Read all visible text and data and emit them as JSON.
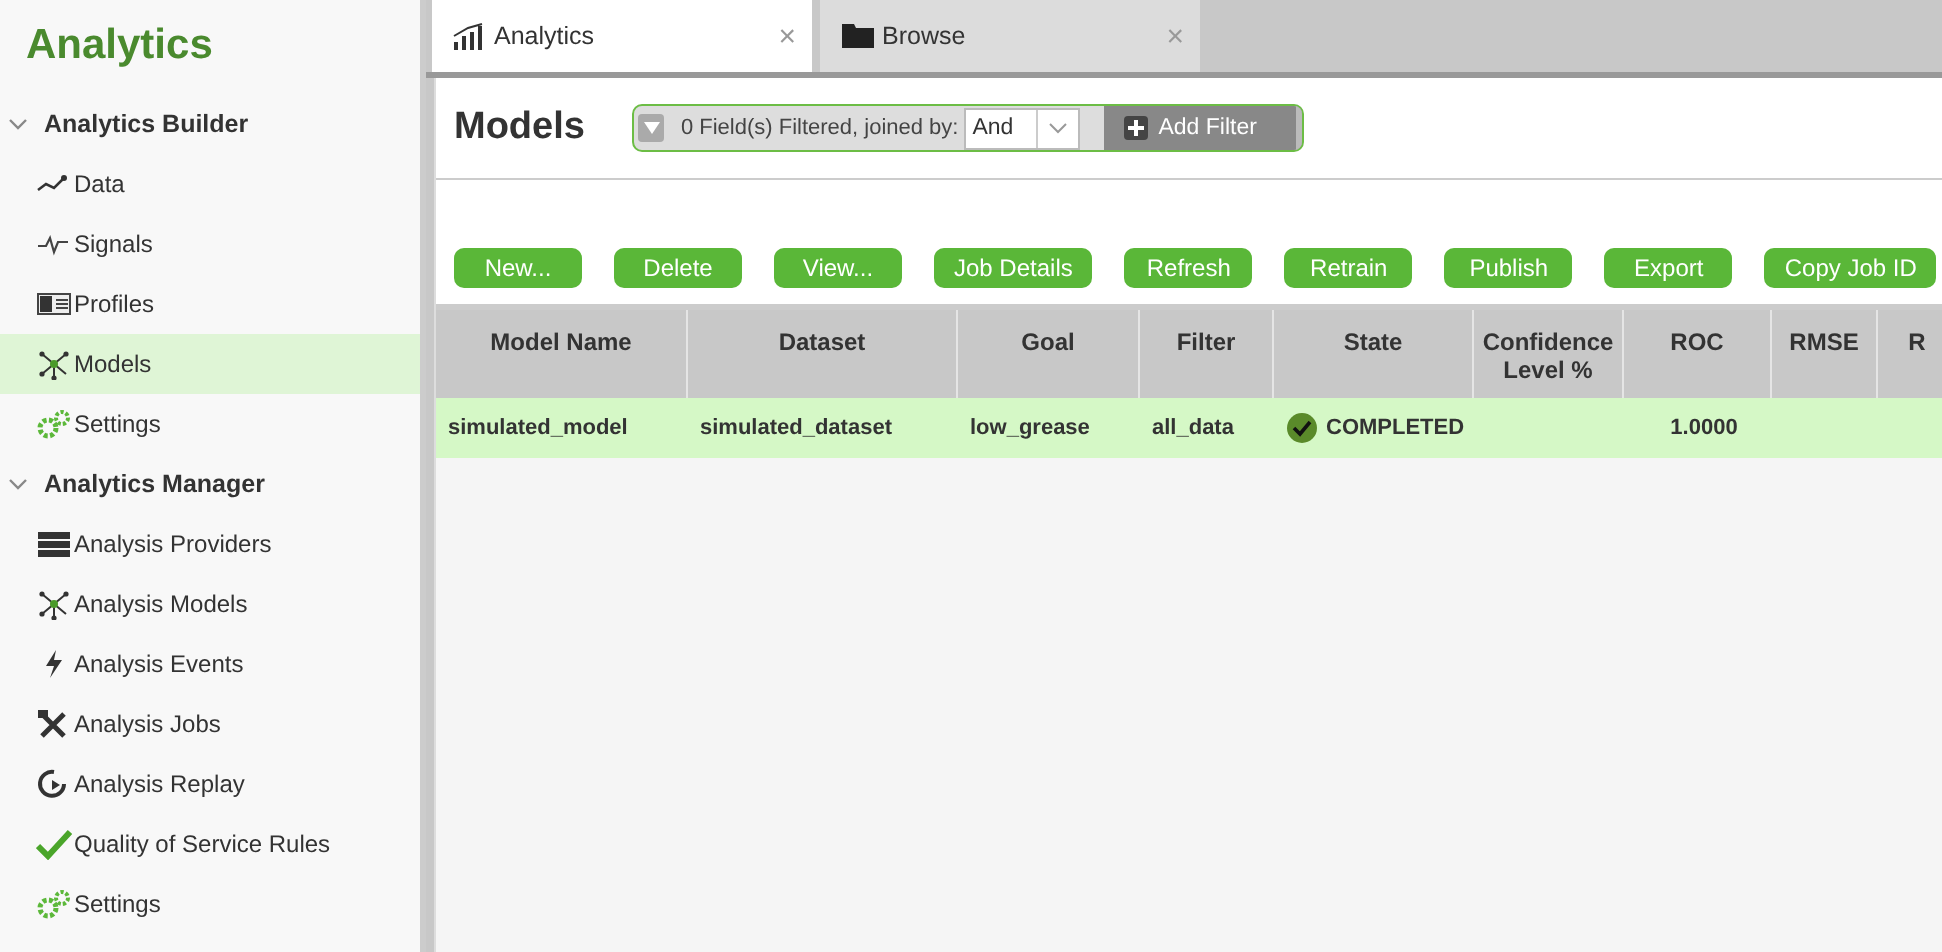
{
  "app_title": "Analytics",
  "sidebar": {
    "sections": [
      {
        "label": "Analytics Builder",
        "expanded": true,
        "items": [
          {
            "label": "Data",
            "kind": "line",
            "selected": false
          },
          {
            "label": "Signals",
            "kind": "pulse",
            "selected": false
          },
          {
            "label": "Profiles",
            "kind": "profile",
            "selected": false
          },
          {
            "label": "Models",
            "kind": "network",
            "selected": true
          },
          {
            "label": "Settings",
            "kind": "gears",
            "selected": false
          }
        ]
      },
      {
        "label": "Analytics Manager",
        "expanded": true,
        "items": [
          {
            "label": "Analysis Providers",
            "kind": "server",
            "selected": false
          },
          {
            "label": "Analysis Models",
            "kind": "network",
            "selected": false
          },
          {
            "label": "Analysis Events",
            "kind": "bolt",
            "selected": false
          },
          {
            "label": "Analysis Jobs",
            "kind": "tools",
            "selected": false
          },
          {
            "label": "Analysis Replay",
            "kind": "replay",
            "selected": false
          },
          {
            "label": "Quality of Service Rules",
            "kind": "check",
            "selected": false
          },
          {
            "label": "Settings",
            "kind": "gears",
            "selected": false
          }
        ]
      }
    ]
  },
  "tabs": [
    {
      "label": "Analytics",
      "kind": "bars",
      "selected": true,
      "close": "×"
    },
    {
      "label": "Browse",
      "kind": "folder",
      "selected": false,
      "close": "×"
    }
  ],
  "page_title": "Models",
  "filter": {
    "summary": "0 Field(s) Filtered, joined by:",
    "join_value": "And",
    "add_label": "Add Filter"
  },
  "buttons": [
    "New...",
    "Delete",
    "View...",
    "Job Details",
    "Refresh",
    "Retrain",
    "Publish",
    "Export",
    "Copy Job ID"
  ],
  "table": {
    "columns": [
      "Model Name",
      "Dataset",
      "Goal",
      "Filter",
      "State",
      "Confidence Level %",
      "ROC",
      "RMSE",
      "R"
    ],
    "rows": [
      {
        "selected": true,
        "cells": [
          "simulated_model",
          "simulated_dataset",
          "low_grease",
          "all_data",
          "COMPLETED",
          "",
          "1.0000",
          "",
          ""
        ],
        "state_ok": true
      }
    ]
  }
}
